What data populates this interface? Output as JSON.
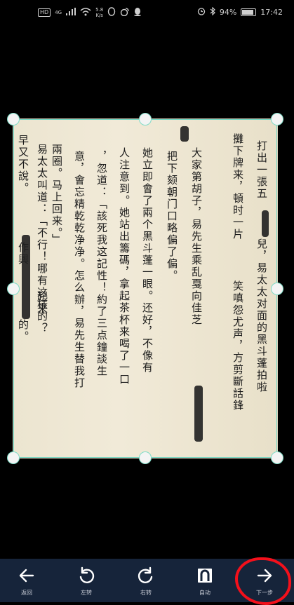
{
  "status_bar": {
    "hd": "HD",
    "network": "4G",
    "speed_value": "5.8",
    "speed_unit": "K/s",
    "battery": "94%",
    "time": "17:42",
    "battery_level": 0.94
  },
  "document": {
    "columns": [
      "打出一張五",
      "攤下牌来，頓时一片",
      "大家第胡子，易先生乘乱戛向佳芝",
      "把下颏朝门口略偏了偏。",
      "她立即會了兩个黑斗蓬一眼。还好，不像有",
      "人注意到。她站出籌碼，拿起茶杯来喝了一口",
      "，忽道：「該死我这記性！約了三点鐘談生",
      "意，會忘精乾乾净净。怎么辦，易先生替我打",
      "兩圈。马上回来。」",
      "易太太叫道：「不行！哪有这樣的？",
      "早又不說。"
    ],
    "col2_lower": "兒，易太太对面的黑斗蓬拍啦",
    "col3_lower": "笑嗔怨尤声，方剪斷話鋒",
    "col10_lower": "起来",
    "col11_lower": "作興",
    "col11_end": "的。"
  },
  "toolbar": {
    "back_label": "返回",
    "rotate_left_label": "左转",
    "rotate_right_label": "右转",
    "auto_label": "自动",
    "next_label": "下一步"
  },
  "colors": {
    "toolbar_bg": "#16243a",
    "crop_accent": "#6fd6c2",
    "annotation_red": "#f4101b"
  }
}
